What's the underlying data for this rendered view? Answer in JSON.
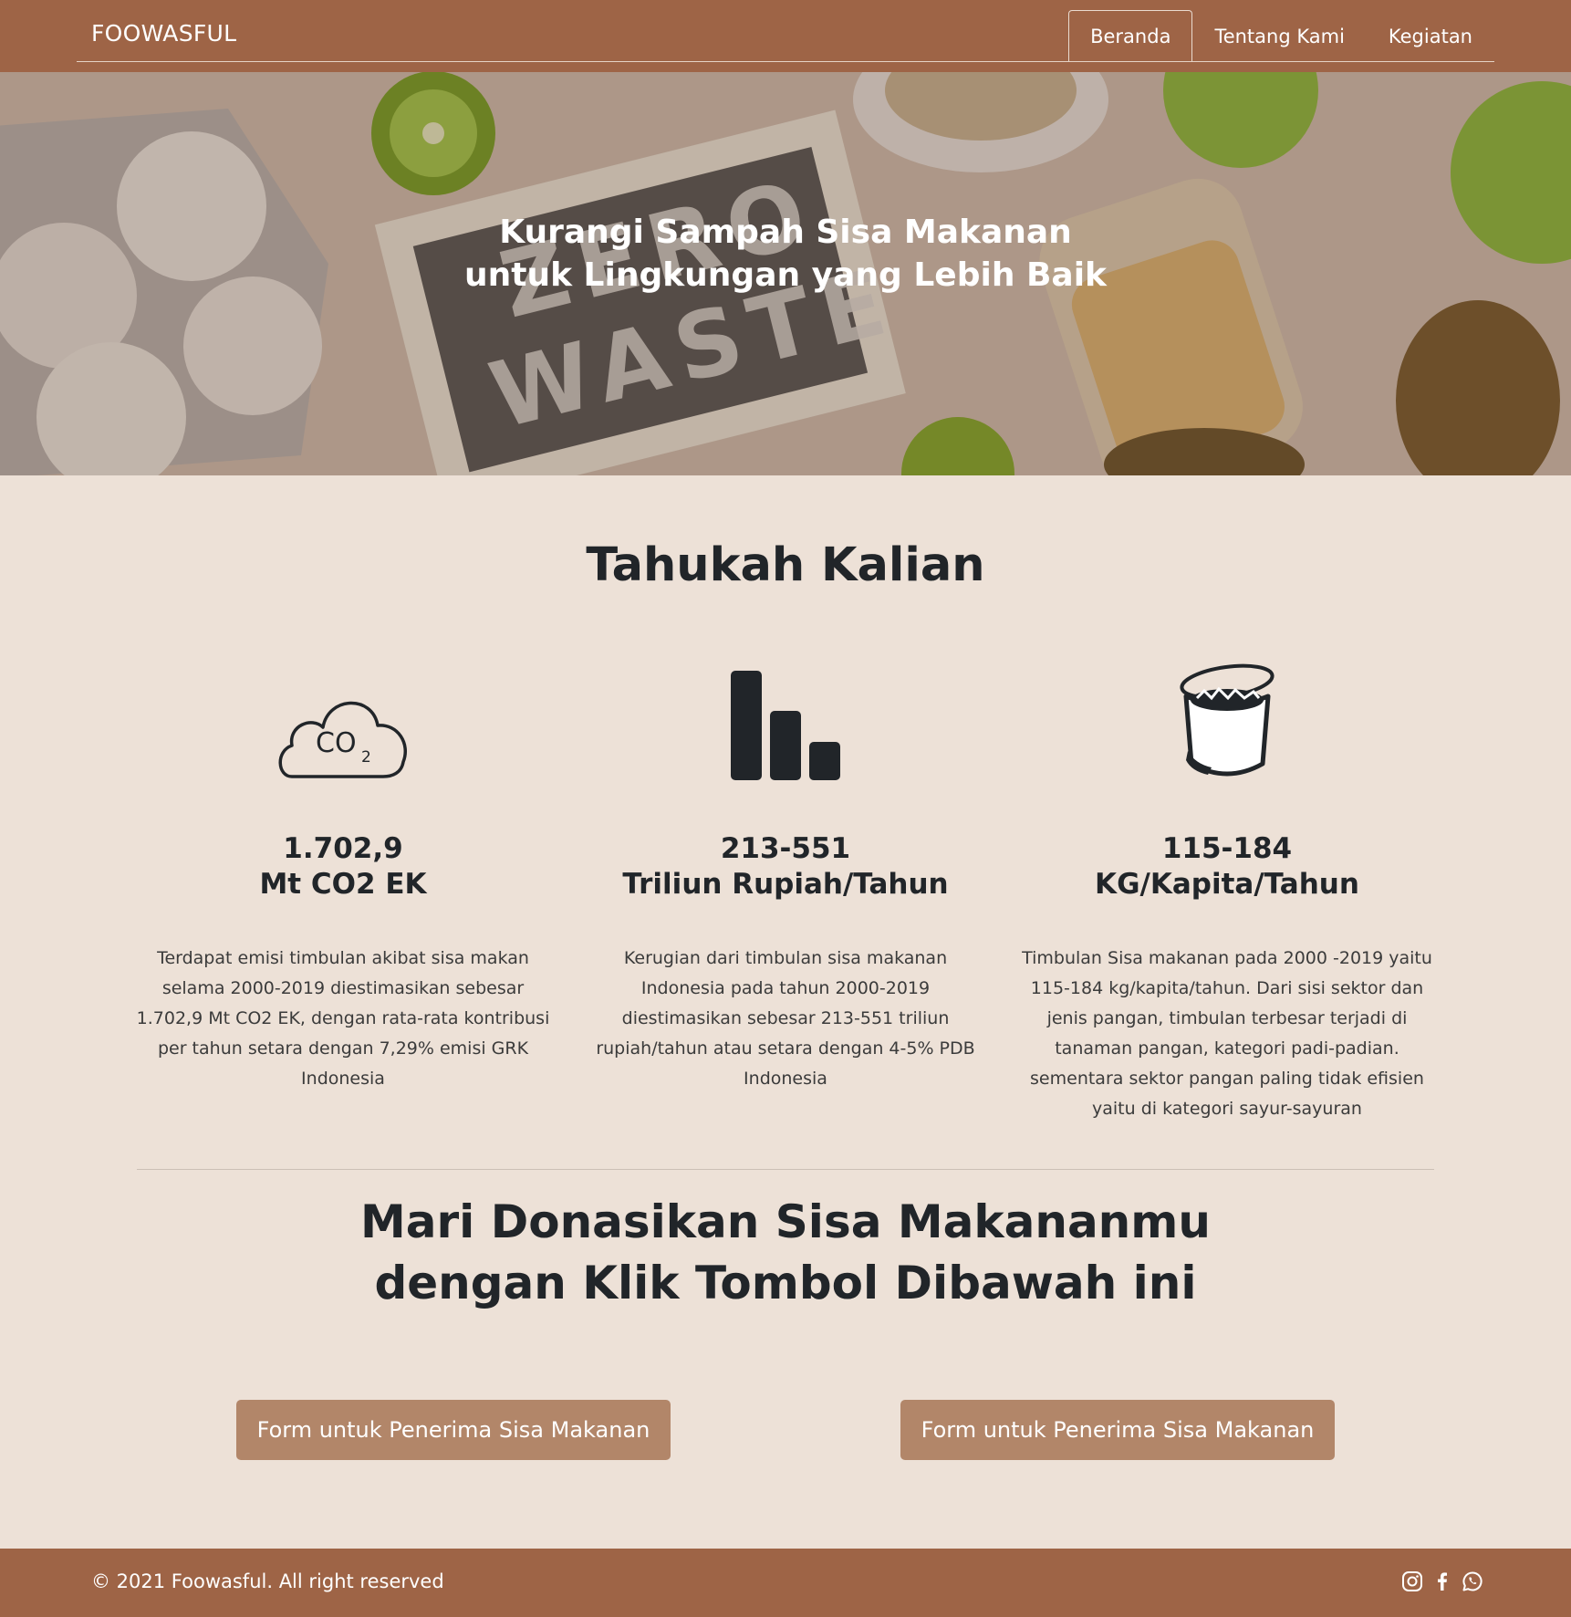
{
  "navbar": {
    "brand": "FOOWASFUL",
    "links": [
      {
        "label": "Beranda",
        "active": true
      },
      {
        "label": "Tentang Kami",
        "active": false
      },
      {
        "label": "Kegiatan",
        "active": false
      }
    ]
  },
  "hero": {
    "title_line1": "Kurangi Sampah Sisa Makanan",
    "title_line2": "untuk Lingkungan yang Lebih Baik",
    "image_text_line1": "ZERO",
    "image_text_line2": "WASTE"
  },
  "facts": {
    "title": "Tahukah Kalian",
    "items": [
      {
        "icon": "co2-cloud-icon",
        "icon_text": "CO",
        "icon_sub": "2",
        "value_line1": "1.702,9",
        "value_line2": "Mt CO2 EK",
        "description": "Terdapat emisi timbulan akibat sisa makan selama 2000-2019 diestimasikan sebesar 1.702,9 Mt CO2 EK, dengan rata-rata kontribusi per tahun setara dengan 7,29% emisi GRK Indonesia"
      },
      {
        "icon": "bar-chart-icon",
        "value_line1": "213-551",
        "value_line2": "Triliun Rupiah/Tahun",
        "description": "Kerugian dari timbulan sisa makanan Indonesia pada tahun 2000-2019 diestimasikan sebesar 213-551 triliun rupiah/tahun atau setara dengan 4-5% PDB Indonesia"
      },
      {
        "icon": "trash-can-icon",
        "value_line1": "115-184",
        "value_line2": "KG/Kapita/Tahun",
        "description": "Timbulan Sisa makanan pada 2000 -2019 yaitu 115-184 kg/kapita/tahun. Dari sisi sektor dan jenis pangan, timbulan terbesar terjadi di tanaman pangan, kategori padi-padian. sementara sektor pangan paling tidak efisien yaitu di kategori sayur-sayuran"
      }
    ]
  },
  "donate": {
    "title_line1": "Mari Donasikan Sisa Makananmu",
    "title_line2": "dengan Klik Tombol Dibawah ini",
    "buttons": [
      {
        "label": "Form untuk Penerima Sisa Makanan"
      },
      {
        "label": "Form untuk Penerima Sisa Makanan"
      }
    ]
  },
  "footer": {
    "copyright": "© 2021 Foowasful. All right reserved",
    "social_icons": [
      "instagram-icon",
      "facebook-icon",
      "whatsapp-icon"
    ]
  },
  "colors": {
    "primary": "#9e6446",
    "background": "#ede1d7",
    "button": "#b28669",
    "text": "#212529"
  }
}
